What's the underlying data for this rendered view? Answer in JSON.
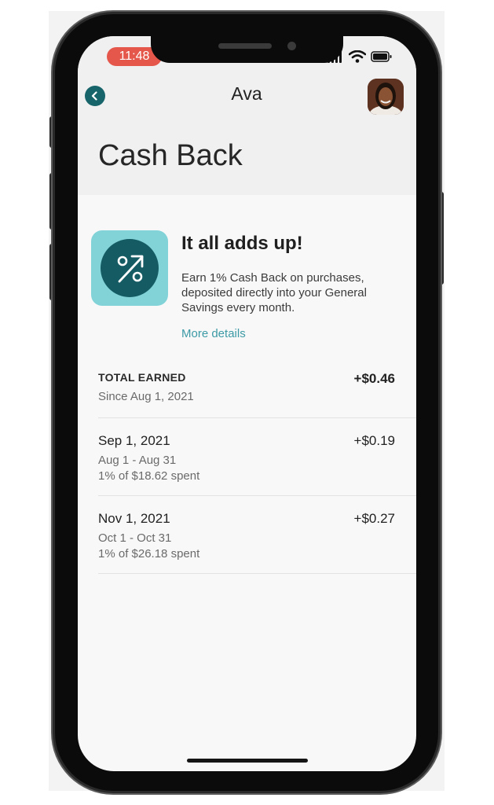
{
  "status_bar": {
    "time": "11:48",
    "icons": [
      "signal-icon",
      "wifi-icon",
      "battery-icon"
    ]
  },
  "nav": {
    "title": "Ava",
    "back_icon": "chevron-left-icon",
    "avatar": "profile-avatar"
  },
  "page": {
    "title": "Cash Back"
  },
  "promo": {
    "icon": "percent-arrow-icon",
    "heading": "It all adds up!",
    "body": "Earn 1% Cash Back on purchases, deposited directly into your General Savings every month.",
    "link": "More details"
  },
  "summary": {
    "label": "TOTAL EARNED",
    "since": "Since Aug 1, 2021",
    "amount": "+$0.46"
  },
  "payouts": [
    {
      "date": "Sep 1, 2021",
      "period": "Aug 1 - Aug 31",
      "detail": "1% of $18.62 spent",
      "amount": "+$0.19"
    },
    {
      "date": "Nov 1, 2021",
      "period": "Oct 1 - Oct 31",
      "detail": "1% of $26.18 spent",
      "amount": "+$0.27"
    }
  ],
  "colors": {
    "accent": "#17646a",
    "icon_bg": "#82d3d8",
    "link": "#3c9aa5",
    "time_pill": "#e4574a"
  }
}
